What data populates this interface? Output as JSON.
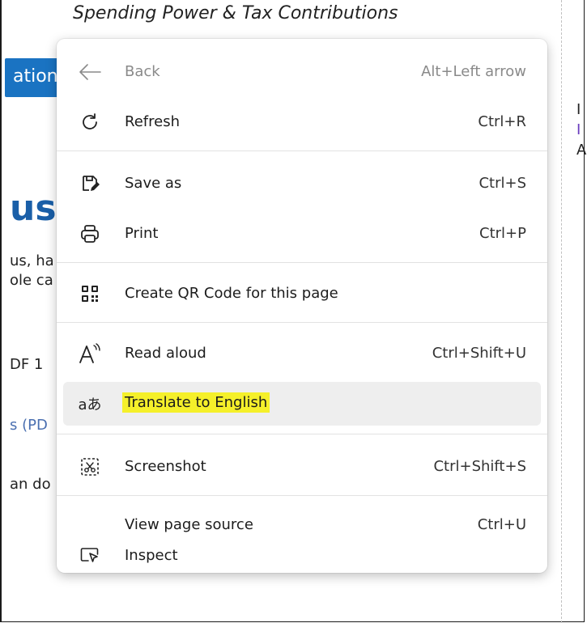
{
  "background": {
    "page_title": "Spending Power & Tax Contributions",
    "tab_text": "ation",
    "heading_fragment": "us",
    "fragments": [
      "us, ha",
      "ole ca",
      "DF 1",
      "s (PD",
      "an do"
    ],
    "right_fragments": [
      "I",
      "I",
      "A"
    ]
  },
  "menu": {
    "items": [
      {
        "label": "Back",
        "shortcut": "Alt+Left arrow",
        "icon": "back-arrow-icon",
        "disabled": true
      },
      {
        "label": "Refresh",
        "shortcut": "Ctrl+R",
        "icon": "refresh-icon"
      },
      {
        "label": "Save as",
        "shortcut": "Ctrl+S",
        "icon": "save-as-icon"
      },
      {
        "label": "Print",
        "shortcut": "Ctrl+P",
        "icon": "print-icon"
      },
      {
        "label": "Create QR Code for this page",
        "shortcut": "",
        "icon": "qr-code-icon"
      },
      {
        "label": "Read aloud",
        "shortcut": "Ctrl+Shift+U",
        "icon": "read-aloud-icon"
      },
      {
        "label": "Translate to English",
        "shortcut": "",
        "icon": "translate-icon",
        "icon_text": "aあ",
        "highlighted": true
      },
      {
        "label": "Screenshot",
        "shortcut": "Ctrl+Shift+S",
        "icon": "screenshot-icon"
      },
      {
        "label": "View page source",
        "shortcut": "Ctrl+U",
        "icon": ""
      },
      {
        "label": "Inspect",
        "shortcut": "",
        "icon": "inspect-icon"
      }
    ],
    "highlight_color": "#f5f02a"
  }
}
